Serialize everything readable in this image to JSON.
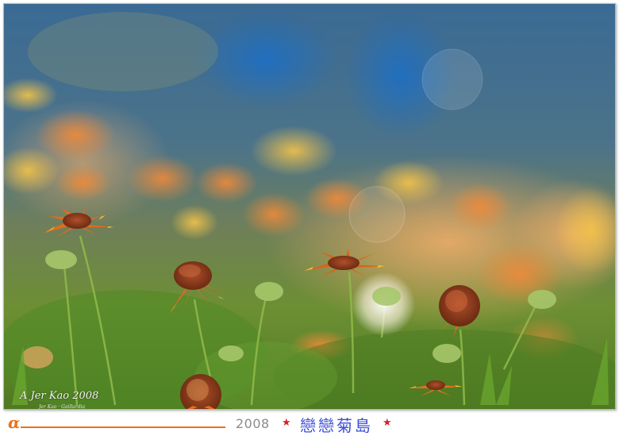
{
  "photo": {
    "description_icon": "flower-field-photo"
  },
  "watermark": {
    "signature": "A Jer Kao 2008",
    "sub": "Jer Kao · Gaillardia"
  },
  "footer": {
    "logo": "α",
    "year": "2008",
    "star_left": "★",
    "caption": "戀戀菊島",
    "star_right": "★"
  },
  "colors": {
    "accent": "#e8731c",
    "caption": "#3c4fd8",
    "star": "#d6202a",
    "sky": "#2b5f8c",
    "foliage": "#5f8f2c"
  }
}
